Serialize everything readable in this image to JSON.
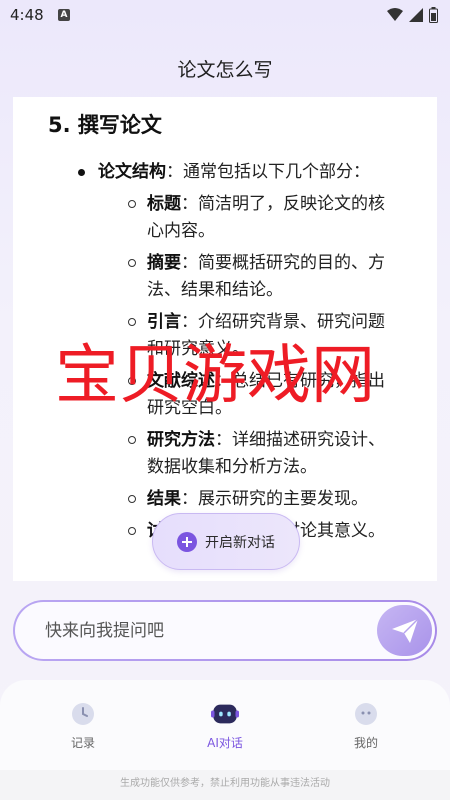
{
  "status_bar": {
    "time": "4:48",
    "notification_letter": "A"
  },
  "header": {
    "title": "论文怎么写"
  },
  "content": {
    "heading": "5. 撰写论文",
    "main_item": {
      "label": "论文结构",
      "text": "：通常包括以下几个部分："
    },
    "sub_items": [
      {
        "label": "标题",
        "text": "：简洁明了，反映论文的核心内容。"
      },
      {
        "label": "摘要",
        "text": "：简要概括研究的目的、方法、结果和结论。"
      },
      {
        "label": "引言",
        "text": "：介绍研究背景、研究问题和研究意义。"
      },
      {
        "label": "文献综述",
        "text": "：总结已有研究，指出研究空白。"
      },
      {
        "label": "研究方法",
        "text": "：详细描述研究设计、数据收集和分析方法。"
      },
      {
        "label": "结果",
        "text": "：展示研究的主要发现。"
      },
      {
        "label": "讨论",
        "text": "：解释结果，讨论其意义。"
      }
    ]
  },
  "watermark": "宝贝游戏网",
  "new_chat_button": {
    "label": "开启新对话"
  },
  "input": {
    "placeholder": "快来向我提问吧"
  },
  "bottom_nav": [
    {
      "label": "记录",
      "icon": "clock-icon"
    },
    {
      "label": "AI对话",
      "icon": "robot-icon"
    },
    {
      "label": "我的",
      "icon": "profile-icon"
    }
  ],
  "footer": {
    "disclaimer": "生成功能仅供参考，禁止利用功能从事违法活动"
  },
  "colors": {
    "accent": "#7b55e0",
    "watermark": "#ee1c25"
  }
}
